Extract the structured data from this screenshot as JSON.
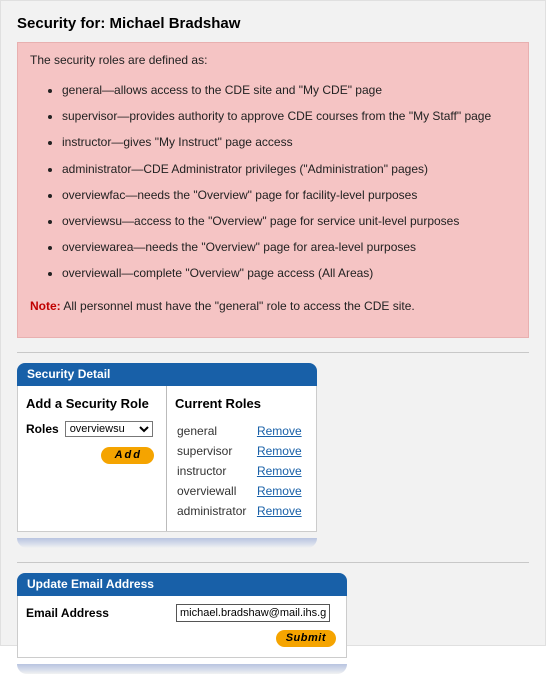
{
  "title_prefix": "Security for: ",
  "person_name": "Michael Bradshaw",
  "info": {
    "intro": "The security roles are defined as:",
    "roles": [
      "general—allows access to the CDE site and \"My CDE\" page",
      "supervisor—provides authority to approve CDE courses from the \"My Staff\" page",
      "instructor—gives \"My Instruct\" page access",
      "administrator—CDE Administrator privileges (\"Administration\" pages)",
      "overviewfac—needs the \"Overview\" page for facility-level purposes",
      "overviewsu—access to the \"Overview\" page for service unit-level purposes",
      "overviewarea—needs the \"Overview\" page for area-level purposes",
      "overviewall—complete \"Overview\" page access (All Areas)"
    ],
    "note_label": "Note:",
    "note_text": " All personnel must have the \"general\" role to access the CDE site."
  },
  "security_detail": {
    "header": "Security Detail",
    "add_heading": "Add a Security Role",
    "roles_label": "Roles",
    "selected_role": "overviewsu",
    "add_button": "Add",
    "current_heading": "Current Roles",
    "remove_label": "Remove",
    "current_roles": [
      "general",
      "supervisor",
      "instructor",
      "overviewall",
      "administrator"
    ]
  },
  "email": {
    "header": "Update Email Address",
    "label": "Email Address",
    "value": "michael.bradshaw@mail.ihs.gov",
    "submit": "Submit"
  }
}
